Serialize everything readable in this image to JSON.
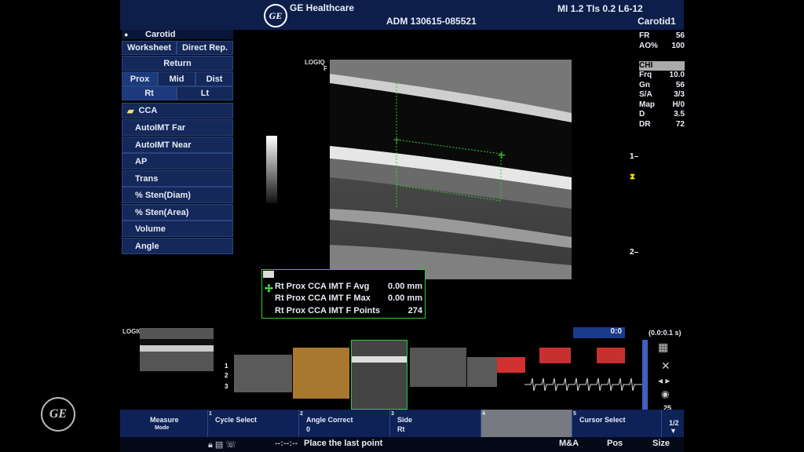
{
  "header": {
    "brand": "GE Healthcare",
    "patient_id": "ADM  130615-085521",
    "mi_tis": "MI 1.2   TIs 0.2  L6-12",
    "preset": "Carotid1",
    "logo_text": "GE"
  },
  "menu": {
    "title": "Carotid",
    "title_icon": "bullet-icon",
    "worksheet": "Worksheet",
    "direct_report": "Direct Rep.",
    "return": "Return",
    "prox": "Prox",
    "mid": "Mid",
    "dist": "Dist",
    "rt": "Rt",
    "lt": "Lt",
    "cca": "CCA",
    "items": [
      "AutoIMT Far",
      "AutoIMT Near",
      "AP",
      "Trans",
      "% Sten(Diam)",
      "% Sten(Area)",
      "Volume",
      "Angle"
    ]
  },
  "image": {
    "logiq_label": "LOGIQ",
    "logiq_sub": "F",
    "logiq_label_small": "LOGIQ"
  },
  "results": {
    "rows": [
      {
        "label": "Rt Prox  CCA IMT F Avg",
        "value": "0.00 mm"
      },
      {
        "label": "Rt Prox  CCA IMT F Max",
        "value": "0.00 mm"
      },
      {
        "label": "Rt Prox  CCA IMT F Points",
        "value": "274"
      }
    ]
  },
  "params": [
    {
      "k": "FR",
      "v": "56"
    },
    {
      "k": "AO%",
      "v": "100"
    },
    {
      "k": "",
      "v": ""
    },
    {
      "k": "CHI",
      "v": ""
    },
    {
      "k": "Frq",
      "v": "10.0"
    },
    {
      "k": "Gn",
      "v": "56"
    },
    {
      "k": "S/A",
      "v": "3/3"
    },
    {
      "k": "Map",
      "v": "H/0"
    },
    {
      "k": "D",
      "v": "3.5"
    },
    {
      "k": "DR",
      "v": "72"
    }
  ],
  "depth": {
    "d1": "1",
    "d2": "2",
    "t1": "1",
    "t2": "2",
    "t3": "3"
  },
  "cine": {
    "counter": "0:0",
    "speed": "(0.0:0.1 s)",
    "frames": "25"
  },
  "softkeys": [
    {
      "num": "",
      "label": "Measure",
      "sub": "Mode"
    },
    {
      "num": "1",
      "label": "Cycle Select",
      "sub": ""
    },
    {
      "num": "2",
      "label": "Angle Correct",
      "sub": "0"
    },
    {
      "num": "3",
      "label": "Side",
      "sub": "Rt"
    },
    {
      "num": "4",
      "label": "",
      "sub": ""
    },
    {
      "num": "5",
      "label": "Cursor Select",
      "sub": ""
    },
    {
      "num": "",
      "label": "1/2",
      "sub": ""
    }
  ],
  "status": {
    "dots": "--:--:--",
    "message": "Place the last point",
    "tab_ma": "M&A",
    "tab_pos": "Pos",
    "tab_size": "Size"
  },
  "colors": {
    "accent_green": "#33cc33",
    "menu_bg": "#14285a",
    "header_bg": "#0d1e4a"
  }
}
